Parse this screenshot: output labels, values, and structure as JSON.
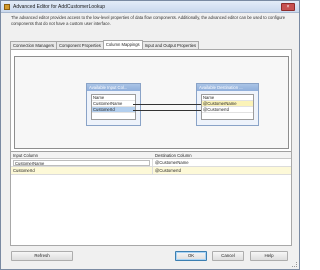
{
  "window": {
    "title": "Advanced Editor for AddCustomerLookup",
    "close_glyph": "×"
  },
  "description": "The advanced editor provides access to the low-level properties of data flow components. Additionally, the advanced editor can be used to configure components that do not have a custom user interface.",
  "tabs": [
    {
      "label": "Connection Managers"
    },
    {
      "label": "Component Properties"
    },
    {
      "label": "Column Mappings",
      "active": true
    },
    {
      "label": "Input and Output Properties"
    }
  ],
  "mapping": {
    "input_box": {
      "title": "Available Input Col...",
      "rows": [
        "Name",
        "CustomerName",
        "CustomerId"
      ]
    },
    "dest_box": {
      "title": "Available Destination ...",
      "rows": [
        "Name",
        "@CustomerName",
        "@CustomerId"
      ]
    }
  },
  "grid": {
    "headers": [
      "Input Column",
      "Destination Column"
    ],
    "rows": [
      {
        "input": "CustomerName",
        "destination": "@CustomerName"
      },
      {
        "input": "CustomerId",
        "destination": "@CustomerId"
      }
    ]
  },
  "buttons": {
    "refresh": "Refresh",
    "ok": "OK",
    "cancel": "Cancel",
    "help": "Help"
  },
  "colors": {
    "title_gradient": "#cbd9ee",
    "box_header": "#8faedb",
    "selected_row": "#b3cfee",
    "highlight_row": "#fbf3b8"
  }
}
